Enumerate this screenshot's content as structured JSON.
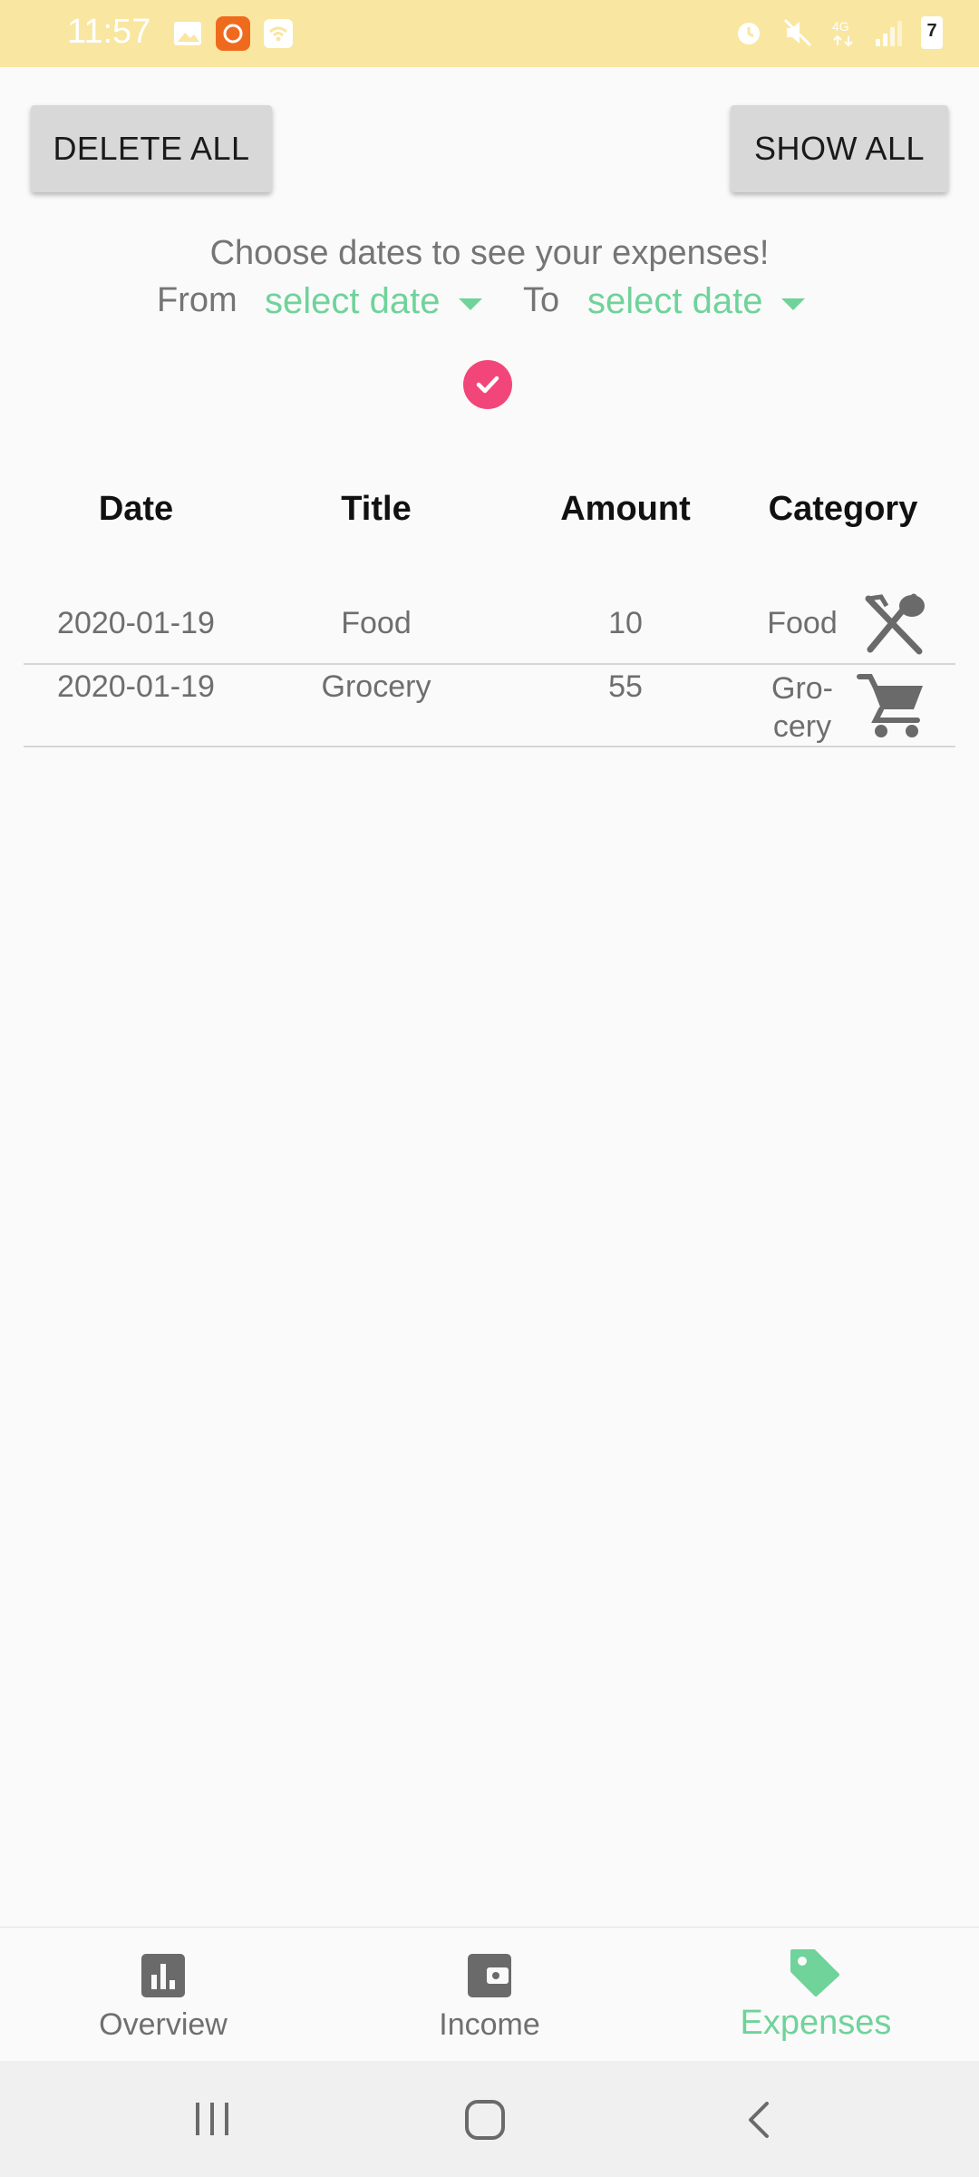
{
  "status_bar": {
    "time": "11:57",
    "icons": [
      "image-icon",
      "app-notification-icon",
      "wifi-icon",
      "alarm-icon",
      "mute-icon",
      "4g-icon",
      "signal-icon",
      "battery-icon"
    ],
    "battery_level": "7"
  },
  "toolbar": {
    "delete_all": "DELETE ALL",
    "show_all": "SHOW ALL"
  },
  "filter": {
    "prompt": "Choose dates to see your expenses!",
    "from_label": "From",
    "from_value": "select date",
    "to_label": "To",
    "to_value": "select date"
  },
  "table": {
    "headers": [
      "Date",
      "Title",
      "Amount",
      "Category"
    ],
    "rows": [
      {
        "date": "2020-01-19",
        "title": "Food",
        "amount": "10",
        "category_line1": "Food",
        "category_line2": "",
        "icon": "fork-spoon-icon"
      },
      {
        "date": "2020-01-19",
        "title": "Grocery",
        "amount": "55",
        "category_line1": "Gro-",
        "category_line2": "cery",
        "icon": "shopping-cart-icon"
      }
    ]
  },
  "bottom_nav": {
    "items": [
      {
        "label": "Overview",
        "icon": "bar-chart-icon",
        "active": false
      },
      {
        "label": "Income",
        "icon": "wallet-icon",
        "active": false
      },
      {
        "label": "Expenses",
        "icon": "tag-icon",
        "active": true
      }
    ]
  },
  "colors": {
    "accent": "#6fd39a",
    "check": "#f2467a",
    "status_bar": "#f9e6a0",
    "button": "#d8d8d8"
  }
}
